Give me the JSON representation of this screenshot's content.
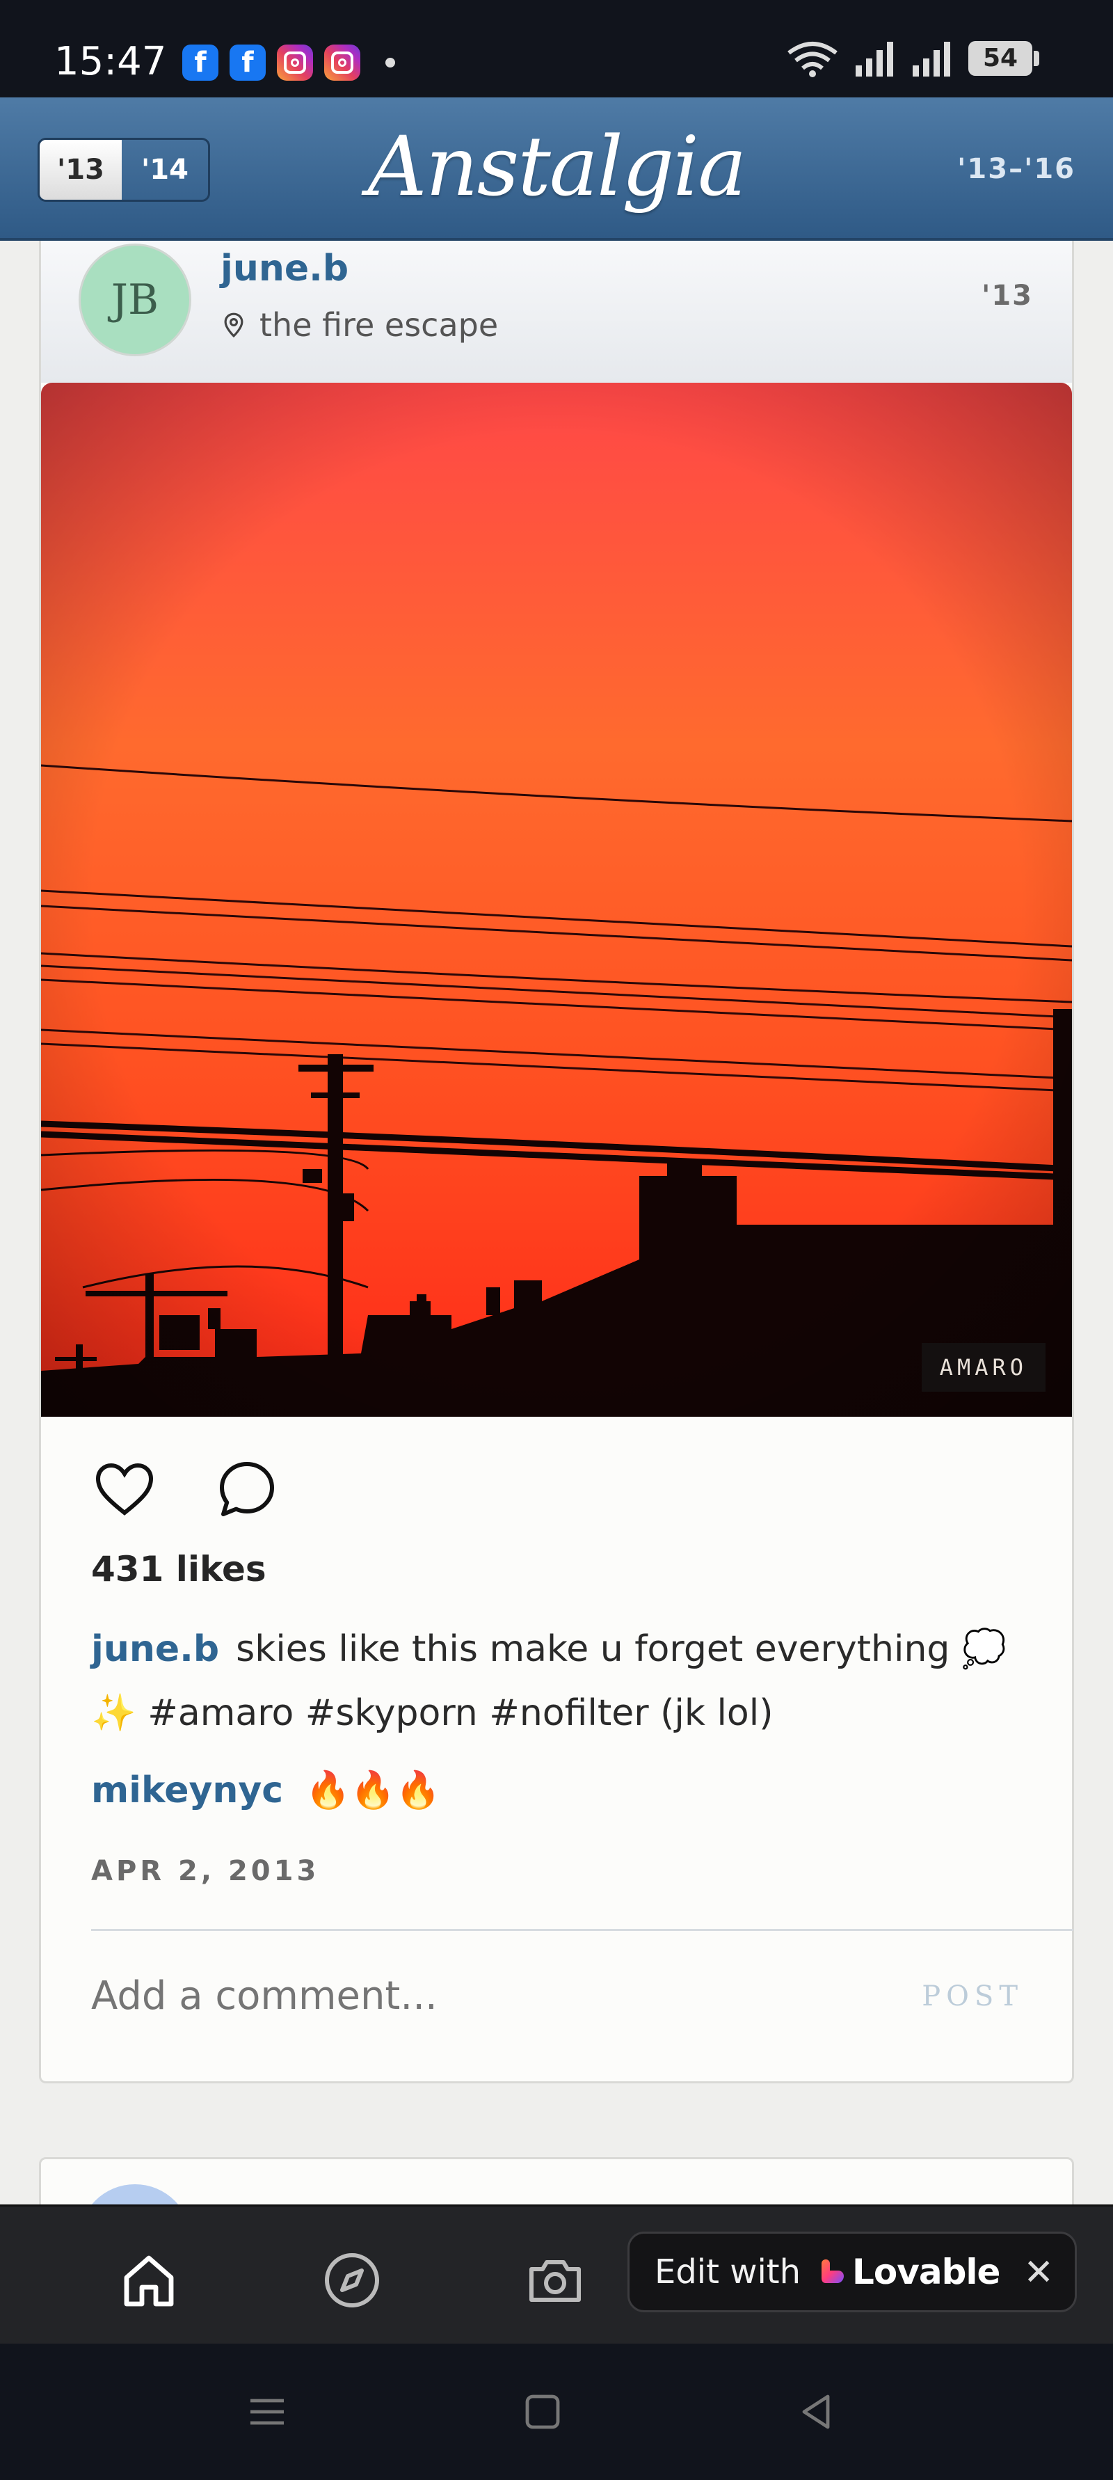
{
  "status_bar": {
    "time": "15:47",
    "notification_icons": [
      "facebook-icon",
      "facebook-icon",
      "instagram-icon",
      "instagram-icon"
    ],
    "battery": "54"
  },
  "header": {
    "brand": "Anstalgia",
    "year_toggle": {
      "selected": "'13",
      "other": "'14"
    },
    "year_range": "'13–'16"
  },
  "post": {
    "avatar_initials": "JB",
    "username": "june.b",
    "location": "the fire escape",
    "year": "'13",
    "filter": "AMARO",
    "likes": "431 likes",
    "caption_user": "june.b",
    "caption_text": "skies like this make u forget everything 💭✨ #amaro #skyporn #nofilter (jk lol)",
    "comment_user": "mikeynyc",
    "comment_text": "🔥🔥🔥",
    "date": "APR 2, 2013",
    "comment_placeholder": "Add a comment...",
    "post_button": "POST"
  },
  "bottom_nav": {
    "items": [
      "home-icon",
      "explore-icon",
      "camera-icon"
    ],
    "lovable_prefix": "Edit with",
    "lovable_brand": "Lovable",
    "close": "✕"
  },
  "colors": {
    "header_blue": "#3a6791",
    "username_blue": "#2f6592",
    "sky_top": "#ff4a4a",
    "sky_bottom": "#ff3a1e"
  }
}
